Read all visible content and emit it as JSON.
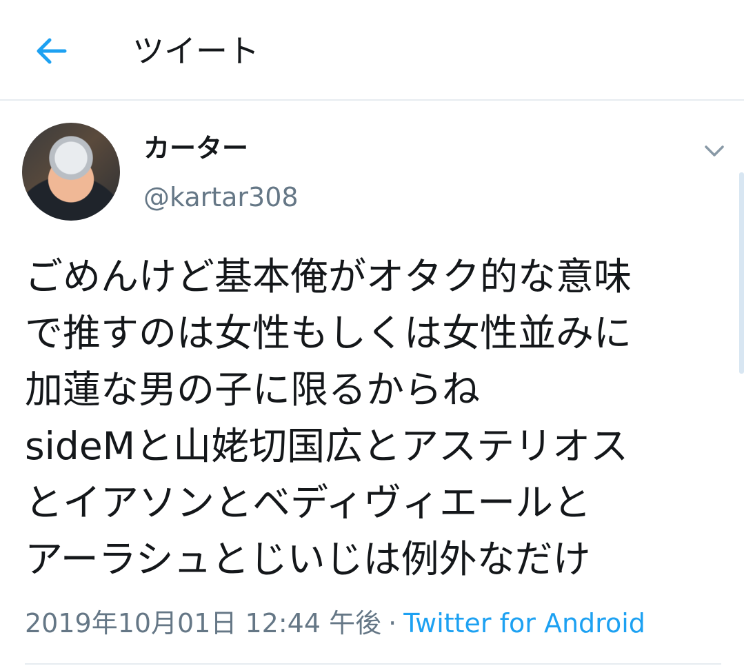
{
  "header": {
    "title": "ツイート",
    "back_icon": "arrow-left-icon",
    "accent": "#1da1f2"
  },
  "tweet": {
    "display_name": "カーター",
    "handle": "@kartar308",
    "avatar": "avatar",
    "menu_icon": "chevron-down-icon",
    "lines": [
      "ごめんけど基本俺がオタク的な意味",
      "で推すのは女性もしくは女性並みに",
      "加蓮な男の子に限るからね",
      "sideMと山姥切国広とアステリオス",
      "とイアソンとベディヴィエールと",
      "アーラシュとじいじは例外なだけ"
    ],
    "timestamp": "2019年10月01日 12:44 午後",
    "separator": "·",
    "source": "Twitter for Android"
  },
  "colors": {
    "text": "#14171a",
    "secondary": "#657786",
    "link": "#1da1f2",
    "divider": "#e6ecf0"
  }
}
